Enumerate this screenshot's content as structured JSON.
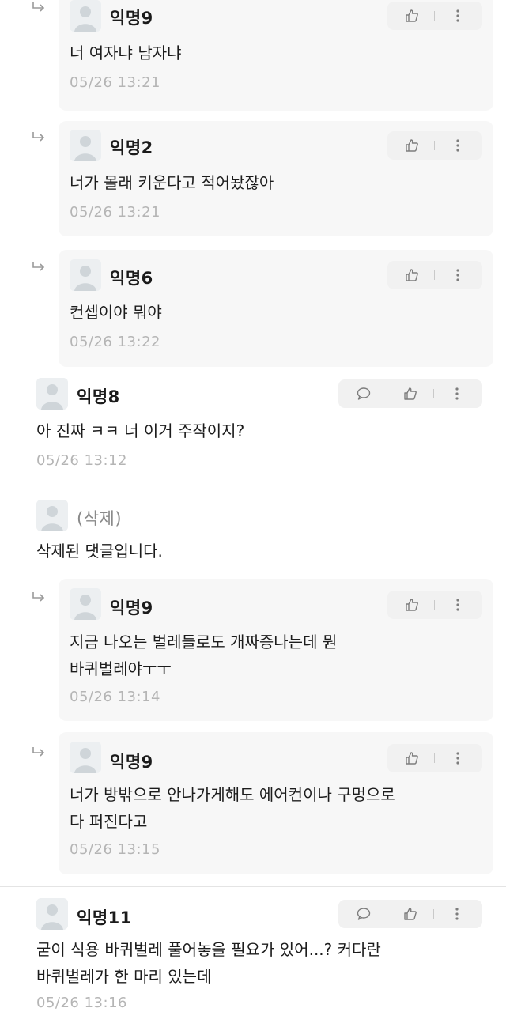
{
  "comments": [
    {
      "author": "익명9",
      "content": "너 여자냐 남자냐",
      "time": "05/26 13:21"
    },
    {
      "author": "익명2",
      "content": "너가 몰래 키운다고 적어놨잖아",
      "time": "05/26 13:21"
    },
    {
      "author": "익명6",
      "content": "컨셉이야 뭐야",
      "time": "05/26 13:22"
    },
    {
      "author": "익명8",
      "content": "아 진짜 ㅋㅋ 너 이거 주작이지?",
      "time": "05/26 13:12"
    },
    {
      "author": "(삭제)",
      "content": "삭제된 댓글입니다."
    },
    {
      "author": "익명9",
      "content": "지금 나오는 벌레들로도 개짜증나는데 뭔\n바퀴벌레야ㅜㅜ",
      "time": "05/26 13:14"
    },
    {
      "author": "익명9",
      "content": "너가 방밖으로 안나가게해도 에어컨이나 구멍으로\n다 퍼진다고",
      "time": "05/26 13:15"
    },
    {
      "author": "익명11",
      "content": "굳이 식용 바퀴벌레 풀어놓을 필요가 있어...? 커다란\n바퀴벌레가 한 마리 있는데",
      "time": "05/26 13:16"
    }
  ],
  "icons": {
    "like": "thumbs-up-icon",
    "more": "more-vertical-icon",
    "reply": "speech-bubble-icon",
    "reply_arrow": "reply-arrow-icon",
    "avatar": "anonymous-avatar-icon"
  },
  "colors": {
    "card_bg": "#f7f7f7",
    "timestamp": "#b5b5b5",
    "deleted_author": "#8a8a8a"
  }
}
